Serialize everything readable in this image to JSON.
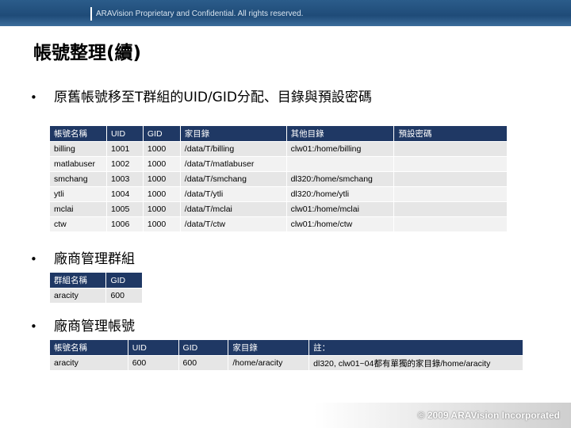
{
  "header": {
    "notice": "ARAVision Proprietary and Confidential. All rights reserved."
  },
  "title": "帳號整理(續)",
  "bullet_glyph": "•",
  "section1": {
    "text": "原舊帳號移至T群組的UID/GID分配、目錄與預設密碼",
    "columns": [
      "帳號名稱",
      "UID",
      "GID",
      "家目錄",
      "其他目錄",
      "預設密碼"
    ],
    "rows": [
      [
        "billing",
        "1001",
        "1000",
        "/data/T/billing",
        "clw01:/home/billing",
        ""
      ],
      [
        "matlabuser",
        "1002",
        "1000",
        "/data/T/matlabuser",
        "",
        ""
      ],
      [
        "smchang",
        "1003",
        "1000",
        "/data/T/smchang",
        "dl320:/home/smchang",
        ""
      ],
      [
        "ytli",
        "1004",
        "1000",
        "/data/T/ytli",
        "dl320:/home/ytli",
        ""
      ],
      [
        "mclai",
        "1005",
        "1000",
        "/data/T/mclai",
        "clw01:/home/mclai",
        ""
      ],
      [
        "ctw",
        "1006",
        "1000",
        "/data/T/ctw",
        "clw01:/home/ctw",
        ""
      ]
    ]
  },
  "section2": {
    "text": "廠商管理群組",
    "columns": [
      "群組名稱",
      "GID"
    ],
    "rows": [
      [
        "aracity",
        "600"
      ]
    ]
  },
  "section3": {
    "text": "廠商管理帳號",
    "columns": [
      "帳號名稱",
      "UID",
      "GID",
      "家目錄",
      "註："
    ],
    "rows": [
      [
        "aracity",
        "600",
        "600",
        "/home/aracity",
        "dl320, clw01~04都有單獨的家目錄/home/aracity"
      ]
    ]
  },
  "footer": {
    "copyright": "© 2009 ARAVision Incorporated"
  },
  "colors": {
    "table_header": "#1f3864",
    "row_shade": "#e6e6e6",
    "header_band": "#2b5c8a"
  }
}
